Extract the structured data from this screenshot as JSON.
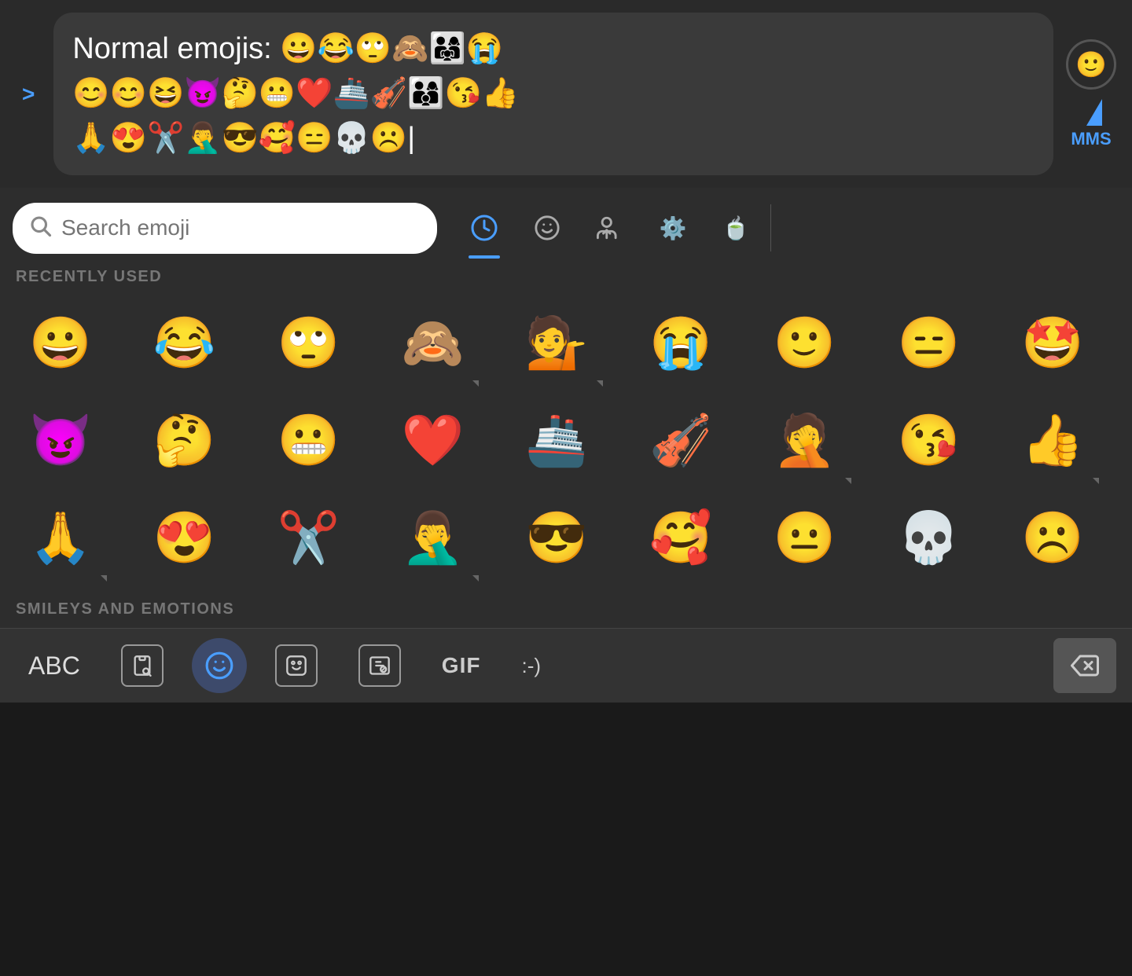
{
  "compose": {
    "chevron": ">",
    "message_text": "Normal emojis: ",
    "message_emojis_line1": "😀😂🙄🙈👨‍👩‍👧😭",
    "message_emojis_line2": "😊😊😆😈🤔😬❤️🚢🎻👨‍👩‍👦😘👍",
    "message_emojis_line3": "🙏😍✂️🤦‍♂️😎🥰😑💀☹️",
    "smiley_btn": "🙂",
    "mms_label": "MMS"
  },
  "search": {
    "placeholder": "Search emoji"
  },
  "categories": [
    {
      "id": "recent",
      "icon": "🕐",
      "active": true
    },
    {
      "id": "smiley",
      "icon": "🙂",
      "active": false
    },
    {
      "id": "people",
      "icon": "🚶",
      "active": false
    },
    {
      "id": "activity",
      "icon": "⚙️",
      "active": false
    },
    {
      "id": "food",
      "icon": "☕",
      "active": false
    }
  ],
  "sections": [
    {
      "label": "RECENTLY USED",
      "emojis": [
        {
          "e": "😀",
          "has_arrow": false
        },
        {
          "e": "😂",
          "has_arrow": false
        },
        {
          "e": "🙄",
          "has_arrow": false
        },
        {
          "e": "🙈",
          "has_arrow": true
        },
        {
          "e": "💁",
          "has_arrow": true
        },
        {
          "e": "😭",
          "has_arrow": false
        },
        {
          "e": "🙂",
          "has_arrow": false
        },
        {
          "e": "😑",
          "has_arrow": false
        },
        {
          "e": "🤩",
          "has_arrow": false
        },
        {
          "e": "😈",
          "has_arrow": false
        },
        {
          "e": "🤔",
          "has_arrow": false
        },
        {
          "e": "😬",
          "has_arrow": false
        },
        {
          "e": "❤️",
          "has_arrow": false
        },
        {
          "e": "🚢",
          "has_arrow": false
        },
        {
          "e": "🎻",
          "has_arrow": false
        },
        {
          "e": "🤦",
          "has_arrow": false
        },
        {
          "e": "😘",
          "has_arrow": false
        },
        {
          "e": "👍",
          "has_arrow": true
        },
        {
          "e": "🙏",
          "has_arrow": true
        },
        {
          "e": "😍",
          "has_arrow": false
        },
        {
          "e": "✂️",
          "has_arrow": false
        },
        {
          "e": "🤦‍♂️",
          "has_arrow": true
        },
        {
          "e": "😎",
          "has_arrow": false
        },
        {
          "e": "🥰",
          "has_arrow": false
        },
        {
          "e": "😐",
          "has_arrow": false
        },
        {
          "e": "💀",
          "has_arrow": false
        },
        {
          "e": "☹️",
          "has_arrow": false
        }
      ]
    }
  ],
  "smileys_section_label": "SMILEYS AND EMOTIONS",
  "keyboard": {
    "abc_label": "ABC",
    "gif_label": "GIF",
    "emoticon_label": ":-)"
  }
}
